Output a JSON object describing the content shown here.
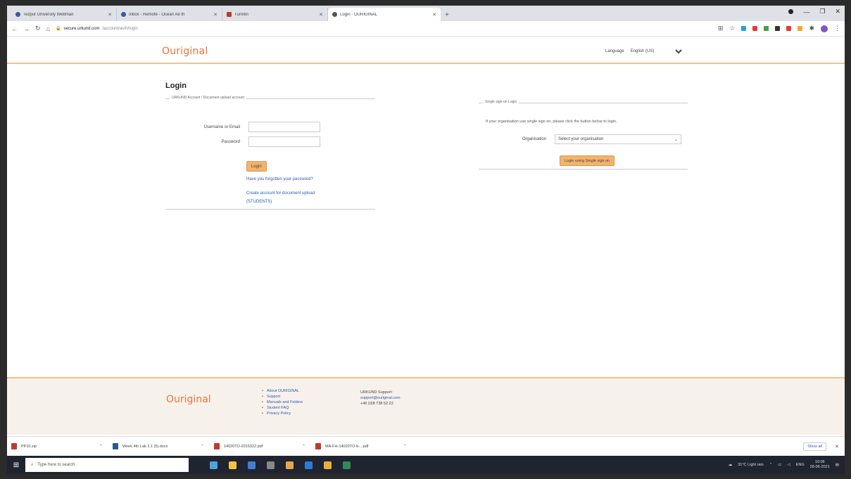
{
  "browser": {
    "tabs": [
      {
        "label": "Tezpur University Webmail",
        "icon": "globe-icon"
      },
      {
        "label": "Inbox - Remote - Ocean Ab th",
        "icon": "globe-icon"
      },
      {
        "label": "Turnitin",
        "icon": "turnitin-icon"
      },
      {
        "label": "Login - OURIGINAL",
        "icon": "ouriginal-icon",
        "active": true
      }
    ],
    "new_tab": "+",
    "address": {
      "host": "secure.urkund.com",
      "path": "/account/auth/login"
    }
  },
  "site": {
    "logo": "Ouriginal",
    "language_label": "Language",
    "language_value": "English (US)"
  },
  "login": {
    "title": "Login",
    "left_legend": "URKUND Account / Document upload account",
    "username_label": "Username or Email",
    "password_label": "Password",
    "login_button": "Login",
    "forgot_link": "Have you forgotten your password?",
    "create_link_line1": "Create account for document upload",
    "create_link_line2": "(STUDENTS)",
    "right_legend": "Single sign-on Login",
    "sso_text": "If your organisation use single sign on, please click the button below to login.",
    "org_label": "Organisation",
    "org_select_value": "Select your organisation",
    "sso_button": "Login using Single sign on"
  },
  "footer": {
    "logo": "Ouriginal",
    "links": [
      "About OURIGINAL",
      "Support",
      "Manuals and Folders",
      "Student FAQ",
      "Privacy Policy"
    ],
    "support_title": "URKUND Support:",
    "support_email": "support@ouriginal.com",
    "support_phone": "+46 (0)8 738 52 23"
  },
  "downloads": {
    "items": [
      {
        "label": "PP10.zip",
        "color": "#c0392b"
      },
      {
        "label": "Week 4th Lab 2.1 (5).docx",
        "color": "#2b579a"
      },
      {
        "label": "14020TO-2015322.pdf",
        "color": "#c0392b"
      },
      {
        "label": "MA-Fin-14020TO-b-...pdf",
        "color": "#c0392b"
      }
    ],
    "show_all": "Show all"
  },
  "taskbar": {
    "search_placeholder": "Type here to search",
    "weather": "31°C Light rain",
    "lang": "ENG",
    "time": "10:06",
    "date": "28-06-2021"
  }
}
